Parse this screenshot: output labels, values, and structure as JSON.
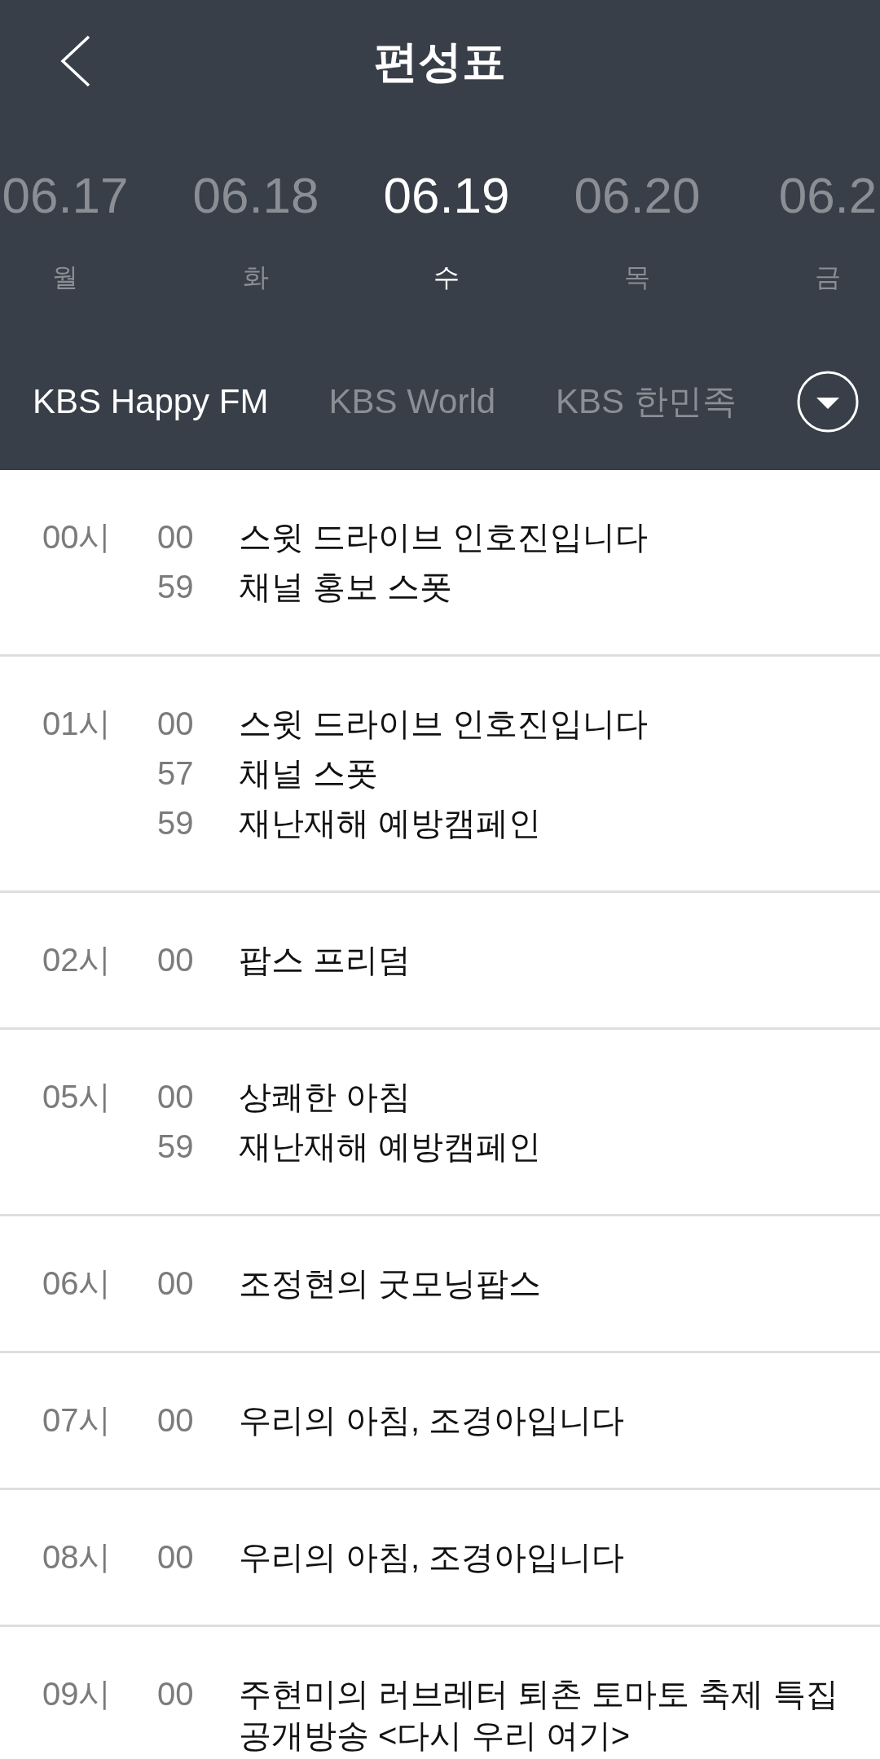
{
  "header": {
    "title": "편성표"
  },
  "dates": [
    {
      "date": "06.17",
      "weekday": "월",
      "selected": false
    },
    {
      "date": "06.18",
      "weekday": "화",
      "selected": false
    },
    {
      "date": "06.19",
      "weekday": "수",
      "selected": true
    },
    {
      "date": "06.20",
      "weekday": "목",
      "selected": false
    },
    {
      "date": "06.2",
      "weekday": "금",
      "selected": false
    }
  ],
  "channels": [
    {
      "label": "KBS Happy FM",
      "selected": true
    },
    {
      "label": "KBS World",
      "selected": false
    },
    {
      "label": "KBS 한민족",
      "selected": false
    }
  ],
  "schedule": [
    {
      "hour": "00시",
      "programs": [
        {
          "minute": "00",
          "title": "스윗 드라이브 인호진입니다"
        },
        {
          "minute": "59",
          "title": "채널 홍보 스폿"
        }
      ]
    },
    {
      "hour": "01시",
      "programs": [
        {
          "minute": "00",
          "title": "스윗 드라이브 인호진입니다"
        },
        {
          "minute": "57",
          "title": "채널 스폿"
        },
        {
          "minute": "59",
          "title": "재난재해 예방캠페인"
        }
      ]
    },
    {
      "hour": "02시",
      "programs": [
        {
          "minute": "00",
          "title": "팝스 프리덤"
        }
      ]
    },
    {
      "hour": "05시",
      "programs": [
        {
          "minute": "00",
          "title": "상쾌한 아침"
        },
        {
          "minute": "59",
          "title": "재난재해 예방캠페인"
        }
      ]
    },
    {
      "hour": "06시",
      "programs": [
        {
          "minute": "00",
          "title": "조정현의 굿모닝팝스"
        }
      ]
    },
    {
      "hour": "07시",
      "programs": [
        {
          "minute": "00",
          "title": "우리의 아침, 조경아입니다"
        }
      ]
    },
    {
      "hour": "08시",
      "programs": [
        {
          "minute": "00",
          "title": "우리의 아침, 조경아입니다"
        }
      ]
    },
    {
      "hour": "09시",
      "programs": [
        {
          "minute": "00",
          "title": "주현미의 러브레터 퇴촌 토마토 축제 특집 공개방송 <다시 우리 여기>"
        }
      ]
    }
  ]
}
